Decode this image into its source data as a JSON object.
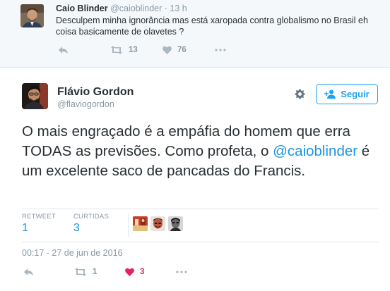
{
  "parent_tweet": {
    "name": "Caio Blinder",
    "handle": "@caioblinder",
    "separator": "·",
    "time": "13 h",
    "text": "Desculpem minha ignorância mas está xaropada contra globalismo no Brasil eh coisa basicamente de olavetes ?",
    "actions": [
      {
        "icon": "reply-icon",
        "count": ""
      },
      {
        "icon": "retweet-icon",
        "count": "13"
      },
      {
        "icon": "heart-icon",
        "count": "76"
      },
      {
        "icon": "more-icon",
        "count": ""
      }
    ]
  },
  "tweet": {
    "name": "Flávio Gordon",
    "handle": "@flaviogordon",
    "follow_label": "Seguir",
    "text_before": "O mais engraçado é a empáfia do homem que erra TODAS as previsões. Como profeta, o ",
    "mention": "@caioblinder",
    "text_after": " é um excelente saco de pancadas do Francis.",
    "stats": {
      "retweets_label": "RETWEET",
      "retweets": "1",
      "likes_label": "CURTIDAS",
      "likes": "3"
    },
    "likers": [
      "liker-avatar-1",
      "liker-avatar-2",
      "liker-avatar-3"
    ],
    "date": "00:17 - 27 de jun de 2016",
    "actions": [
      {
        "icon": "reply-icon",
        "count": ""
      },
      {
        "icon": "retweet-icon",
        "count": "1"
      },
      {
        "icon": "heart-icon",
        "count": "3"
      },
      {
        "icon": "more-icon",
        "count": ""
      }
    ]
  },
  "colors": {
    "accent": "#1da1f2",
    "link": "#1b95e0",
    "muted": "#8899a6",
    "like": "#e0245e",
    "parent_bg": "#f5f8fa",
    "border": "#e1e8ed"
  }
}
